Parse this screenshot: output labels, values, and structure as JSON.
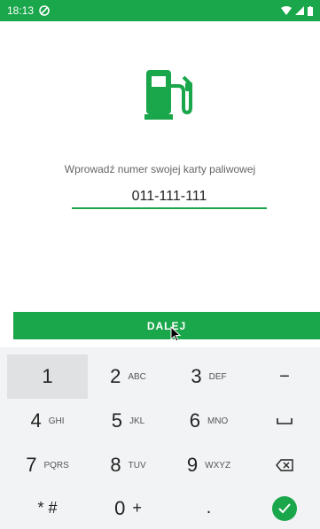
{
  "status_bar": {
    "time": "18:13",
    "app_icon": "disabled-circle-icon",
    "icons": [
      "wifi-icon",
      "signal-icon",
      "battery-icon"
    ],
    "bg": "#1aa64a"
  },
  "icon": {
    "name": "fuel-pump-icon",
    "color": "#1aa64a"
  },
  "prompt": {
    "text": "Wprowadź numer swojej karty paliwowej"
  },
  "card_number": {
    "value": "011-111-111"
  },
  "next_button": {
    "label": "DALEJ"
  },
  "keypad": {
    "keys": [
      {
        "main": "1",
        "sub": ""
      },
      {
        "main": "2",
        "sub": "ABC"
      },
      {
        "main": "3",
        "sub": "DEF"
      },
      {
        "main": "−",
        "sub": ""
      },
      {
        "main": "4",
        "sub": "GHI"
      },
      {
        "main": "5",
        "sub": "JKL"
      },
      {
        "main": "6",
        "sub": "MNO"
      },
      {
        "main": "␣",
        "sub": ""
      },
      {
        "main": "7",
        "sub": "PQRS"
      },
      {
        "main": "8",
        "sub": "TUV"
      },
      {
        "main": "9",
        "sub": "WXYZ"
      },
      {
        "main": "⌫",
        "sub": ""
      },
      {
        "main": "* #",
        "sub": ""
      },
      {
        "main": "0",
        "sub": "+"
      },
      {
        "main": ".",
        "sub": ""
      },
      {
        "main": "✓",
        "sub": ""
      }
    ]
  }
}
